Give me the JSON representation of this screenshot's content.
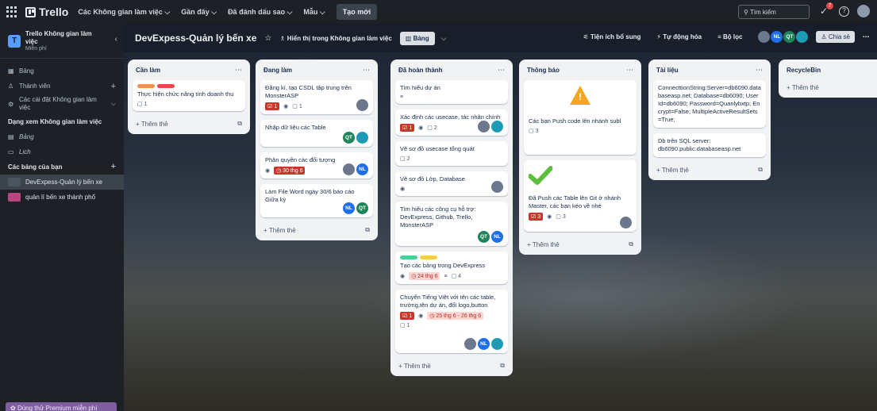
{
  "topbar": {
    "logo": "Trello",
    "nav": [
      "Các Không gian làm việc ⌵",
      "Gần đây ⌵",
      "Đã đánh dấu sao ⌵",
      "Mẫu ⌵"
    ],
    "create": "Tạo mới",
    "search_placeholder": "Tìm kiếm",
    "notif_count": "7"
  },
  "sidebar": {
    "ws_initial": "T",
    "ws_name": "Trello Không gian làm việc",
    "ws_plan": "Miễn phí",
    "items": [
      {
        "icon": "▦",
        "label": "Bảng"
      },
      {
        "icon": "♙",
        "label": "Thành viên"
      },
      {
        "icon": "⚙",
        "label": "Các cài đặt Không gian làm việc"
      }
    ],
    "views_title": "Dạng xem Không gian làm việc",
    "views": [
      {
        "icon": "▤",
        "label": "Bảng"
      },
      {
        "icon": "▭",
        "label": "Lịch"
      }
    ],
    "boards_title": "Các bảng của bạn",
    "boards": [
      {
        "label": "DevExpess-Quản lý bến xe",
        "color": "#4a5560"
      },
      {
        "label": "quản lí bến xe thành phố",
        "color": "#b8457e"
      }
    ],
    "premium": "Dùng thử Premium miễn phí"
  },
  "board": {
    "title": "DevExpess-Quản lý bến xe",
    "visibility": "Hiển thị trong Không gian làm việc",
    "view": "Bảng",
    "powerups": "Tiện ích bổ sung",
    "automation": "Tự động hóa",
    "filter": "Bộ lọc",
    "share": "Chia sẻ",
    "members": [
      {
        "initials": "",
        "color": "#6b778c"
      },
      {
        "initials": "NL",
        "color": "#1f6feb"
      },
      {
        "initials": "QT",
        "color": "#1f845a"
      },
      {
        "initials": "",
        "color": "#1d9bb5"
      }
    ]
  },
  "lists": [
    {
      "title": "Cần làm",
      "cards": [
        {
          "labels": [
            "#f5914a",
            "#e5484d"
          ],
          "title": "Thực hiện chức năng tính doanh thu",
          "comments": "1"
        }
      ],
      "add": "Thêm thẻ"
    },
    {
      "title": "Đang làm",
      "cards": [
        {
          "title": "Đăng kí, tạo CSDL tập trung trên MonsterASP",
          "red": "1",
          "comments": "1"
        },
        {
          "title": "Nhập dữ liệu các Table"
        },
        {
          "title": "Phân quyền các đối tượng",
          "date": "30 thg 6"
        },
        {
          "title": "Làm File Word ngày 30/6 báo cáo Giữa kỳ"
        }
      ],
      "add": "Thêm thẻ"
    },
    {
      "title": "Đã hoàn thành",
      "cards": [
        {
          "title": "Tìm hiểu dự án"
        },
        {
          "title": "Xác định các usecase, tác nhân chính",
          "red": "1",
          "comments": "2"
        },
        {
          "title": "Vẽ sơ đồ usecase tổng quát",
          "comments": "2"
        },
        {
          "title": "Vẽ sơ đồ Lớp, Database"
        },
        {
          "title": "Tìm hiểu các công cụ hỗ trợ: DevExpress, Github, Trello, MonsterASP"
        },
        {
          "labels": [
            "#4bce97",
            "#f5cd47"
          ],
          "title": "Tạo các bảng trong DevExpress",
          "date": "24 thg 6",
          "comments": "4"
        },
        {
          "title": "Chuyển Tiếng Việt với tên các table, trường,tên dự án, đổi logo,button",
          "red": "1",
          "date": "25 thg 6 - 26 thg 6",
          "comments": "1"
        }
      ],
      "add": "Thêm thẻ"
    },
    {
      "title": "Thông báo",
      "cards": [
        {
          "title": "Các bạn Push code lên nhánh subl",
          "comments": "3"
        },
        {
          "title": "Đã Push các Table lên Git ở nhánh Master, các bạn kéo về nhé",
          "red": "3",
          "comments": "3"
        }
      ],
      "add": "Thêm thẻ"
    },
    {
      "title": "Tài liệu",
      "cards": [
        {
          "title": "ConnecttionString:Server=db6090.databaseasp.net; Database=db6090; User Id=db6090; Password=Quanlybxtp; Encrypt=False; MultipleActiveResultSets=True;"
        },
        {
          "title": "Db trên SQL server: db6090.public.databaseasp.net"
        }
      ],
      "add": "Thêm thẻ"
    },
    {
      "title": "RecycleBin",
      "cards": [],
      "add": "Thêm thẻ"
    }
  ],
  "avatars": {
    "QT": "#1f845a",
    "NL": "#1f6feb",
    "cyan": "#1d9bb5",
    "gray": "#6b778c"
  }
}
